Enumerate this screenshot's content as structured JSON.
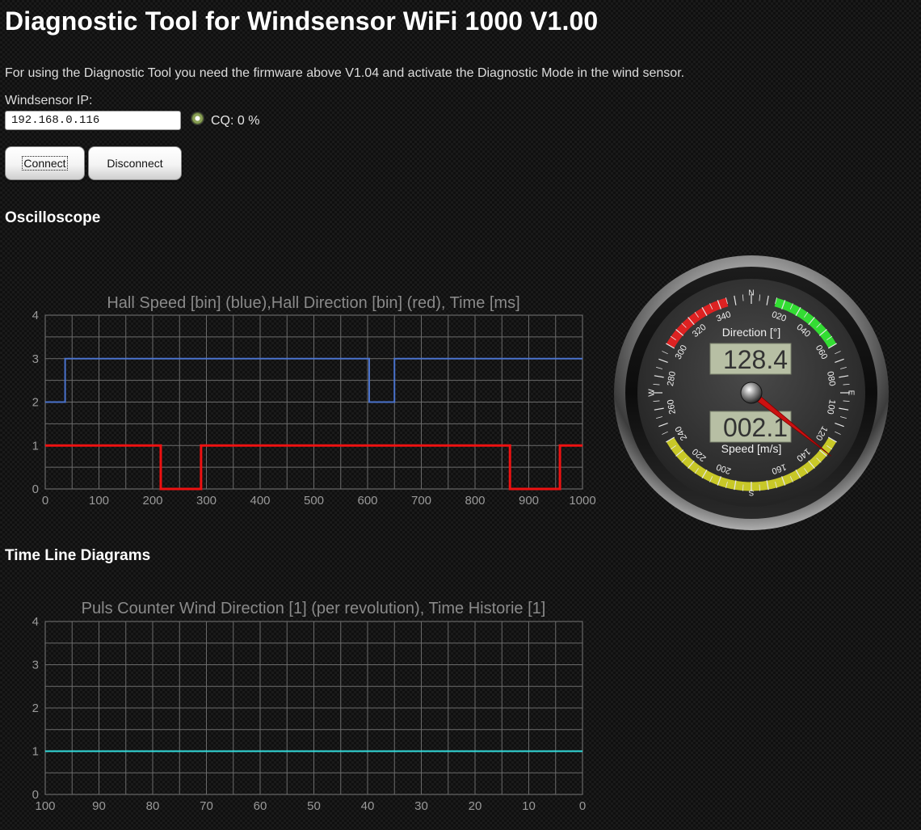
{
  "header": {
    "title": "Diagnostic Tool for Windsensor WiFi 1000 V1.00",
    "intro": "For using the Diagnostic Tool you need the firmware above V1.04 and activate the Diagnostic Mode in the wind sensor."
  },
  "connection": {
    "ip_label": "Windsensor IP:",
    "ip_value": "192.168.0.116",
    "cq_text": "CQ: 0 %",
    "connect_label": "Connect",
    "disconnect_label": "Disconnect"
  },
  "sections": {
    "oscilloscope": "Oscilloscope",
    "timeline": "Time Line Diagrams"
  },
  "gauge": {
    "direction_label": "Direction [°]",
    "direction_value": "128.4",
    "speed_label": "Speed [m/s]",
    "speed_value": "002.1",
    "needle_degrees": 128.4,
    "cardinals": [
      "N",
      "E",
      "S",
      "W"
    ],
    "degree_labels": [
      "020",
      "040",
      "060",
      "080",
      "100",
      "120",
      "140",
      "160",
      "200",
      "220",
      "240",
      "260",
      "280",
      "300",
      "320",
      "340"
    ],
    "colors": {
      "red_zone": "#dd2222",
      "green_zone": "#33dd33",
      "yellow_zone": "#c8c828",
      "needle": "#cc1111"
    }
  },
  "chart_data": [
    {
      "type": "line",
      "title": "Hall Speed [bin] (blue),Hall Direction [bin] (red), Time [ms]",
      "xlim": [
        0,
        1000
      ],
      "ylim": [
        0,
        4
      ],
      "x_ticks": [
        "0",
        "100",
        "200",
        "300",
        "400",
        "500",
        "600",
        "700",
        "800",
        "900",
        "1000"
      ],
      "y_ticks": [
        "0",
        "1",
        "2",
        "3",
        "4"
      ],
      "grid": true,
      "series": [
        {
          "color": "#4a72cc",
          "step": true,
          "x": [
            0,
            37,
            603,
            650,
            1000
          ],
          "y": [
            2,
            3,
            2,
            3,
            3
          ]
        },
        {
          "color": "#ee1111",
          "step": true,
          "x": [
            0,
            215,
            290,
            865,
            958,
            1000
          ],
          "y": [
            1,
            0,
            1,
            0,
            1,
            1
          ]
        }
      ]
    },
    {
      "type": "line",
      "title": "Puls Counter Wind Direction [1] (per revolution), Time Historie [1]",
      "xlim": [
        100,
        0
      ],
      "ylim": [
        0,
        4
      ],
      "x_ticks": [
        "100",
        "90",
        "80",
        "70",
        "60",
        "50",
        "40",
        "30",
        "20",
        "10",
        "0"
      ],
      "y_ticks": [
        "0",
        "1",
        "2",
        "3",
        "4"
      ],
      "grid": true,
      "series": [
        {
          "color": "#33dddd",
          "step": true,
          "x": [
            100,
            0
          ],
          "y": [
            1,
            1
          ]
        }
      ]
    }
  ]
}
